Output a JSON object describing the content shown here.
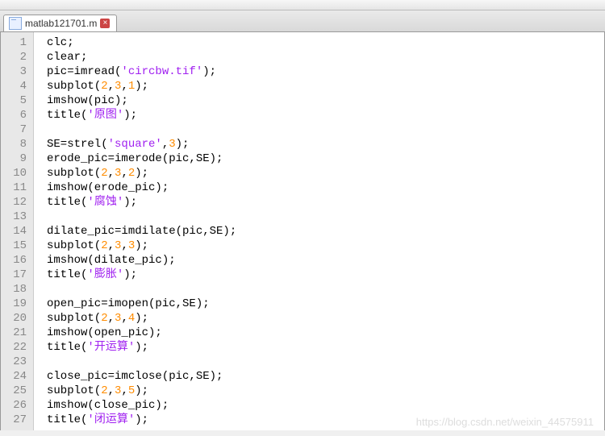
{
  "tab": {
    "filename": "matlab121701.m",
    "close_glyph": "×"
  },
  "code_lines": [
    {
      "n": 1,
      "tokens": [
        "clc;"
      ]
    },
    {
      "n": 2,
      "tokens": [
        "clear;"
      ]
    },
    {
      "n": 3,
      "tokens": [
        "pic=imread(",
        {
          "t": "str",
          "v": "'circbw.tif'"
        },
        ");"
      ]
    },
    {
      "n": 4,
      "tokens": [
        "subplot(",
        {
          "t": "num",
          "v": "2"
        },
        ",",
        {
          "t": "num",
          "v": "3"
        },
        ",",
        {
          "t": "num",
          "v": "1"
        },
        ");"
      ]
    },
    {
      "n": 5,
      "tokens": [
        "imshow(pic);"
      ]
    },
    {
      "n": 6,
      "tokens": [
        "title(",
        {
          "t": "str",
          "v": "'原图'"
        },
        ");"
      ]
    },
    {
      "n": 7,
      "tokens": [
        ""
      ]
    },
    {
      "n": 8,
      "tokens": [
        "SE=strel(",
        {
          "t": "str",
          "v": "'square'"
        },
        ",",
        {
          "t": "num",
          "v": "3"
        },
        ");"
      ]
    },
    {
      "n": 9,
      "tokens": [
        "erode_pic=imerode(pic,SE);"
      ]
    },
    {
      "n": 10,
      "tokens": [
        "subplot(",
        {
          "t": "num",
          "v": "2"
        },
        ",",
        {
          "t": "num",
          "v": "3"
        },
        ",",
        {
          "t": "num",
          "v": "2"
        },
        ");"
      ]
    },
    {
      "n": 11,
      "tokens": [
        "imshow(erode_pic);"
      ]
    },
    {
      "n": 12,
      "tokens": [
        "title(",
        {
          "t": "str",
          "v": "'腐蚀'"
        },
        ");"
      ]
    },
    {
      "n": 13,
      "tokens": [
        ""
      ]
    },
    {
      "n": 14,
      "tokens": [
        "dilate_pic=imdilate(pic,SE);"
      ]
    },
    {
      "n": 15,
      "tokens": [
        "subplot(",
        {
          "t": "num",
          "v": "2"
        },
        ",",
        {
          "t": "num",
          "v": "3"
        },
        ",",
        {
          "t": "num",
          "v": "3"
        },
        ");"
      ]
    },
    {
      "n": 16,
      "tokens": [
        "imshow(dilate_pic);"
      ]
    },
    {
      "n": 17,
      "tokens": [
        "title(",
        {
          "t": "str",
          "v": "'膨胀'"
        },
        ");"
      ]
    },
    {
      "n": 18,
      "tokens": [
        ""
      ]
    },
    {
      "n": 19,
      "tokens": [
        "open_pic=imopen(pic,SE);"
      ]
    },
    {
      "n": 20,
      "tokens": [
        "subplot(",
        {
          "t": "num",
          "v": "2"
        },
        ",",
        {
          "t": "num",
          "v": "3"
        },
        ",",
        {
          "t": "num",
          "v": "4"
        },
        ");"
      ]
    },
    {
      "n": 21,
      "tokens": [
        "imshow(open_pic);"
      ]
    },
    {
      "n": 22,
      "tokens": [
        "title(",
        {
          "t": "str",
          "v": "'开运算'"
        },
        ");"
      ]
    },
    {
      "n": 23,
      "tokens": [
        ""
      ]
    },
    {
      "n": 24,
      "tokens": [
        "close_pic=imclose(pic,SE);"
      ]
    },
    {
      "n": 25,
      "tokens": [
        "subplot(",
        {
          "t": "num",
          "v": "2"
        },
        ",",
        {
          "t": "num",
          "v": "3"
        },
        ",",
        {
          "t": "num",
          "v": "5"
        },
        ");"
      ]
    },
    {
      "n": 26,
      "tokens": [
        "imshow(close_pic);"
      ]
    },
    {
      "n": 27,
      "tokens": [
        "title(",
        {
          "t": "str",
          "v": "'闭运算'"
        },
        ");"
      ]
    }
  ],
  "watermark": "https://blog.csdn.net/weixin_44575911"
}
